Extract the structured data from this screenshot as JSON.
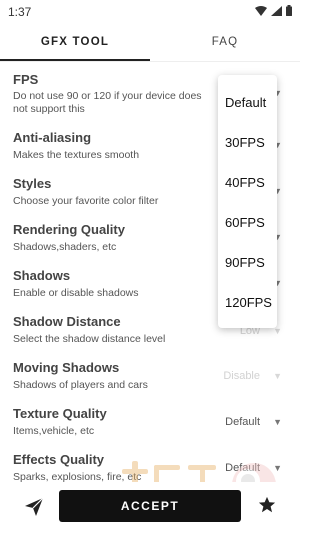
{
  "status_bar": {
    "time": "1:37"
  },
  "tabs": [
    {
      "label": "GFX TOOL",
      "active": true
    },
    {
      "label": "FAQ",
      "active": false
    }
  ],
  "settings": [
    {
      "id": "fps",
      "title": "FPS",
      "description_lines": [
        "Do not use 90 or 120 if your device does",
        "not support this"
      ],
      "value": ""
    },
    {
      "id": "anti-aliasing",
      "title": "Anti-aliasing",
      "description_lines": [
        "Makes the textures smooth"
      ],
      "value": ""
    },
    {
      "id": "styles",
      "title": "Styles",
      "description_lines": [
        "Choose your favorite color filter"
      ],
      "value": ""
    },
    {
      "id": "rendering-quality",
      "title": "Rendering Quality",
      "description_lines": [
        "Shadows,shaders, etc"
      ],
      "value": ""
    },
    {
      "id": "shadows",
      "title": "Shadows",
      "description_lines": [
        "Enable or disable shadows"
      ],
      "value": ""
    },
    {
      "id": "shadow-distance",
      "title": "Shadow Distance",
      "description_lines": [
        "Select the shadow distance level"
      ],
      "value": "Low"
    },
    {
      "id": "moving-shadows",
      "title": "Moving Shadows",
      "description_lines": [
        "Shadows of players and cars"
      ],
      "value": "Disable"
    },
    {
      "id": "texture-quality",
      "title": "Texture Quality",
      "description_lines": [
        "Items,vehicle, etc"
      ],
      "value": "Default"
    },
    {
      "id": "effects-quality",
      "title": "Effects Quality",
      "description_lines": [
        "Sparks, explosions, fire, etc"
      ],
      "value": "Default"
    }
  ],
  "fps_dropdown": {
    "options": [
      "Default",
      "30FPS",
      "40FPS",
      "60FPS",
      "90FPS",
      "120FPS"
    ]
  },
  "bottom_bar": {
    "accept_label": "ACCEPT"
  },
  "icons": {
    "share": "send-icon",
    "favorite": "star-icon",
    "dropdown": "triangle-down-icon"
  }
}
